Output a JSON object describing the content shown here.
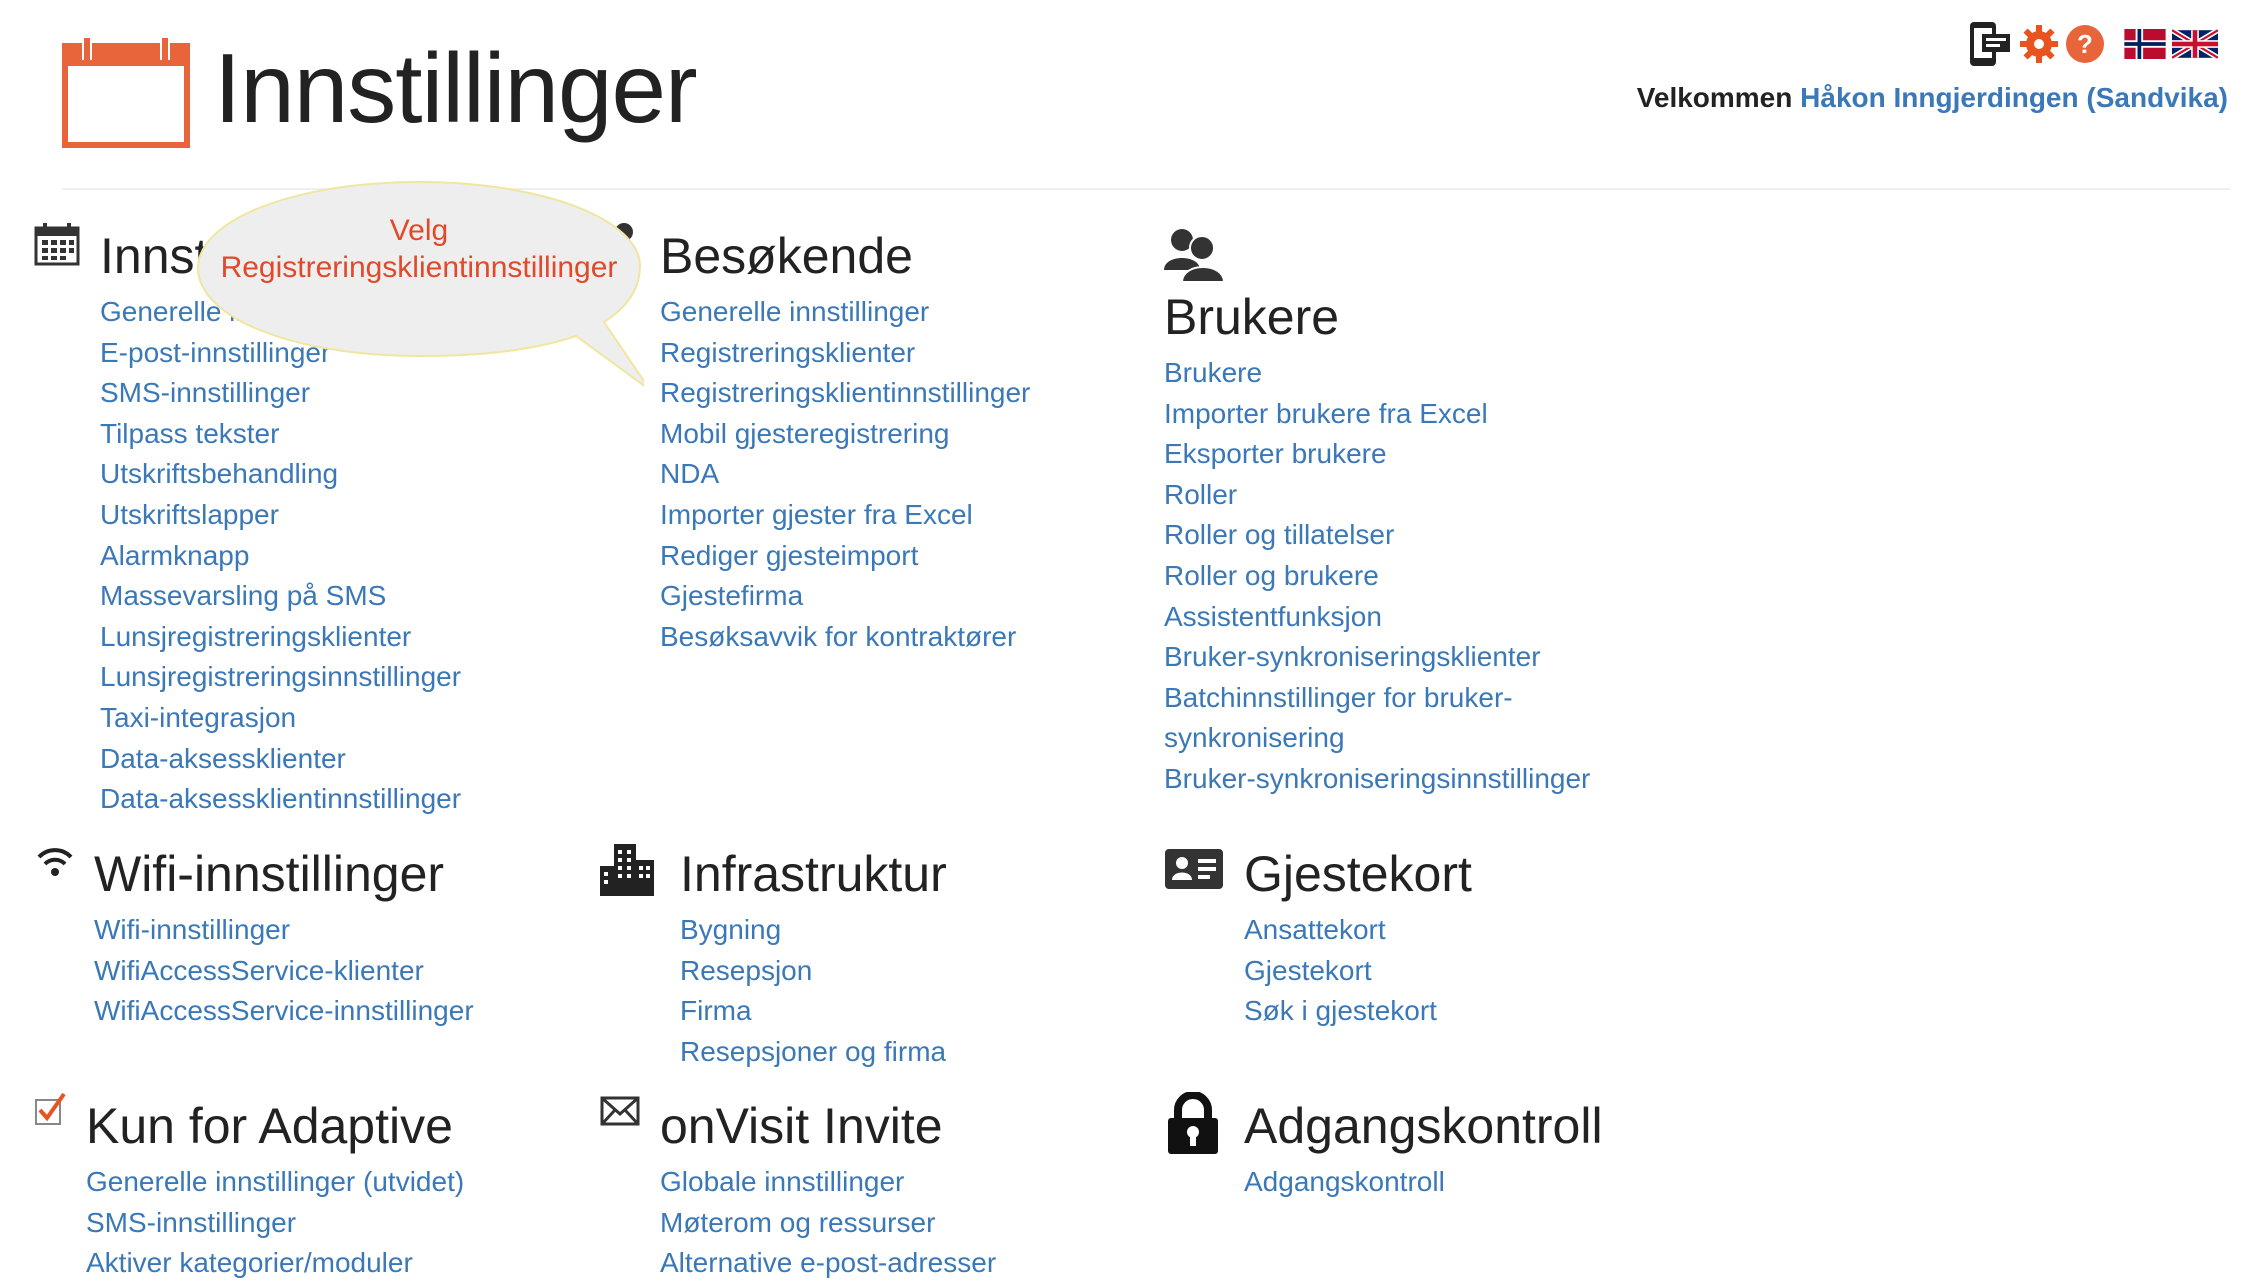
{
  "header": {
    "title": "Innstillinger",
    "welcome_prefix": "Velkommen",
    "welcome_user": "Håkon Inngjerdingen (Sandvika)"
  },
  "top_icons": [
    "mobile-checkin-icon",
    "settings-gear-icon",
    "help-icon",
    "norwegian-flag-icon",
    "english-flag-icon"
  ],
  "colors": {
    "accent_orange": "#e8643a",
    "link_blue": "#3a78b8",
    "callout_fill": "#eeeeee",
    "callout_border": "#f0e6a0",
    "callout_text": "#e04a2a"
  },
  "callout": {
    "line1": "Velg",
    "line2": "Registreringsklientinnstillinger"
  },
  "sections": {
    "innstillinger": {
      "title": "Innstillinger",
      "links": [
        "Generelle innstillinger",
        "E-post-innstillinger",
        "SMS-innstillinger",
        "Tilpass tekster",
        "Utskriftsbehandling",
        "Utskriftslapper",
        "Alarmknapp",
        "Massevarsling på SMS",
        "Lunsjregistreringsklienter",
        "Lunsjregistreringsinnstillinger",
        "Taxi-integrasjon",
        "Data-aksessklienter",
        "Data-aksessklientinnstillinger"
      ]
    },
    "besokende": {
      "title": "Besøkende",
      "links": [
        "Generelle innstillinger",
        "Registreringsklienter",
        "Registreringsklientinnstillinger",
        "Mobil gjesteregistrering",
        "NDA",
        "Importer gjester fra Excel",
        "Rediger gjesteimport",
        "Gjestefirma",
        "Besøksavvik for kontraktører"
      ]
    },
    "brukere": {
      "title": "Brukere",
      "links": [
        "Brukere",
        "Importer brukere fra Excel",
        "Eksporter brukere",
        "Roller",
        "Roller og tillatelser",
        "Roller og brukere",
        "Assistentfunksjon",
        "Bruker-synkroniseringsklienter",
        "Batchinnstillinger for bruker-synkronisering",
        "Bruker-synkroniseringsinnstillinger"
      ]
    },
    "wifi": {
      "title": "Wifi-innstillinger",
      "links": [
        "Wifi-innstillinger",
        "WifiAccessService-klienter",
        "WifiAccessService-innstillinger"
      ]
    },
    "infrastruktur": {
      "title": "Infrastruktur",
      "links": [
        "Bygning",
        "Resepsjon",
        "Firma",
        "Resepsjoner og firma"
      ]
    },
    "gjestekort": {
      "title": "Gjestekort",
      "links": [
        "Ansattekort",
        "Gjestekort",
        "Søk i gjestekort"
      ]
    },
    "adaptive": {
      "title": "Kun for Adaptive",
      "links": [
        "Generelle innstillinger (utvidet)",
        "SMS-innstillinger",
        "Aktiver kategorier/moduler"
      ]
    },
    "invite": {
      "title": "onVisit Invite",
      "links": [
        "Globale innstillinger",
        "Møterom og ressurser",
        "Alternative e-post-adresser"
      ]
    },
    "adgang": {
      "title": "Adgangskontroll",
      "links": [
        "Adgangskontroll"
      ]
    }
  }
}
